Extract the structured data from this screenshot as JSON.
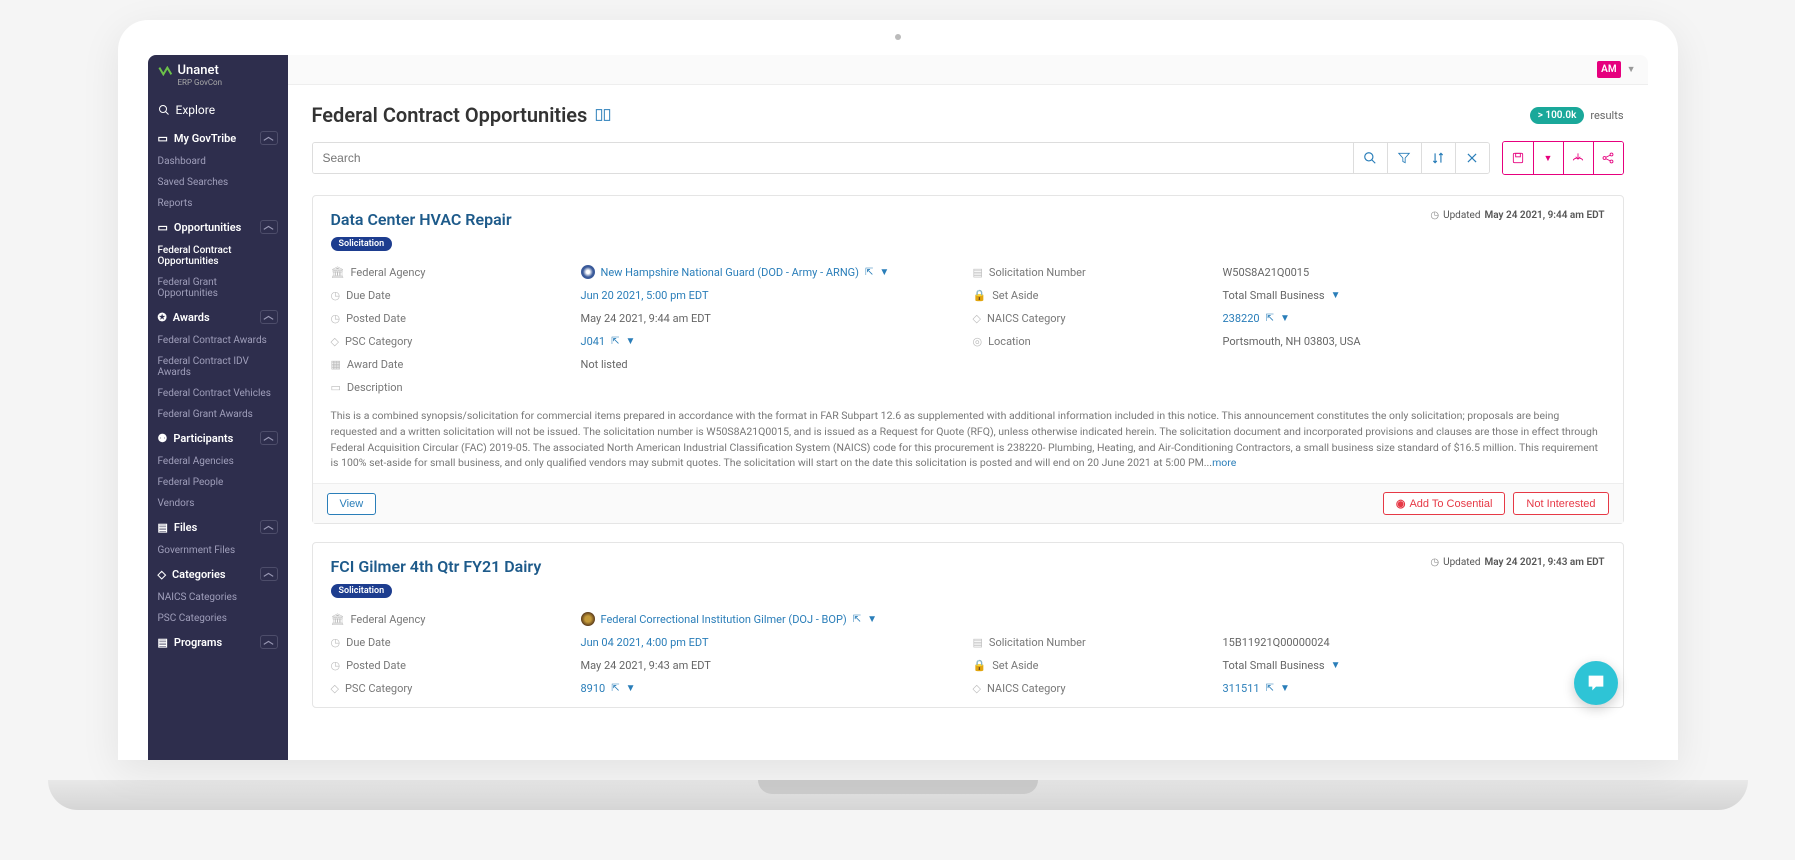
{
  "brand": {
    "name": "Unanet",
    "sub": "ERP GovCon"
  },
  "sidebar": {
    "explore": "Explore",
    "sections": [
      {
        "label": "My GovTribe",
        "items": [
          "Dashboard",
          "Saved Searches",
          "Reports"
        ]
      },
      {
        "label": "Opportunities",
        "items": [
          "Federal Contract Opportunities",
          "Federal Grant Opportunities"
        ],
        "active": 0
      },
      {
        "label": "Awards",
        "items": [
          "Federal Contract Awards",
          "Federal Contract IDV Awards",
          "Federal Contract Vehicles",
          "Federal Grant Awards"
        ]
      },
      {
        "label": "Participants",
        "items": [
          "Federal Agencies",
          "Federal People",
          "Vendors"
        ]
      },
      {
        "label": "Files",
        "items": [
          "Government Files"
        ]
      },
      {
        "label": "Categories",
        "items": [
          "NAICS Categories",
          "PSC Categories"
        ]
      },
      {
        "label": "Programs",
        "items": []
      }
    ]
  },
  "user": {
    "initials": "AM"
  },
  "page": {
    "title": "Federal Contract Opportunities",
    "results_count": "> 100.0k",
    "results_label": "results",
    "search_placeholder": "Search"
  },
  "cards": [
    {
      "title": "Data Center HVAC Repair",
      "tag": "Solicitation",
      "updated_label": "Updated",
      "updated_value": "May 24 2021, 9:44 am EDT",
      "fields": {
        "agency_label": "Federal Agency",
        "agency_value": "New Hampshire National Guard (DOD - Army - ARNG)",
        "sol_label": "Solicitation Number",
        "sol_value": "W50S8A21Q0015",
        "due_label": "Due Date",
        "due_value": "Jun 20 2021, 5:00 pm EDT",
        "setaside_label": "Set Aside",
        "setaside_value": "Total Small Business",
        "posted_label": "Posted Date",
        "posted_value": "May 24 2021, 9:44 am EDT",
        "naics_label": "NAICS Category",
        "naics_value": "238220",
        "psc_label": "PSC Category",
        "psc_value": "J041",
        "loc_label": "Location",
        "loc_value": "Portsmouth, NH 03803, USA",
        "award_label": "Award Date",
        "award_value": "Not listed",
        "desc_label": "Description",
        "desc_value": "This is a combined synopsis/solicitation for commercial items prepared in accordance with the format in FAR Subpart 12.6 as supplemented with additional information included in this notice. This announcement constitutes the only solicitation; proposals are being requested and a written solicitation will not be issued. The solicitation number is W50S8A21Q0015, and is issued as a Request for Quote (RFQ), unless otherwise indicated herein. The solicitation document and incorporated provisions and clauses are those in effect through Federal Acquisition Circular (FAC) 2019-05. The associated North American Industrial Classification System (NAICS) code for this procurement is 238220- Plumbing, Heating, and Air-Conditioning Contractors, a small business size standard of $16.5 million. This requirement is 100% set-aside for small business, and only qualified vendors may submit quotes. The solicitation will start on the date this solicitation is posted and will end on 20 June 2021 at 5:00 PM...",
        "more": "more"
      },
      "actions": {
        "view": "View",
        "cosential": "Add To Cosential",
        "not_interested": "Not Interested"
      }
    },
    {
      "title": "FCI Gilmer 4th Qtr FY21 Dairy",
      "tag": "Solicitation",
      "updated_label": "Updated",
      "updated_value": "May 24 2021, 9:43 am EDT",
      "fields": {
        "agency_label": "Federal Agency",
        "agency_value": "Federal Correctional Institution Gilmer (DOJ - BOP)",
        "sol_label": "Solicitation Number",
        "sol_value": "15B11921Q00000024",
        "due_label": "Due Date",
        "due_value": "Jun 04 2021, 4:00 pm EDT",
        "setaside_label": "Set Aside",
        "setaside_value": "Total Small Business",
        "posted_label": "Posted Date",
        "posted_value": "May 24 2021, 9:43 am EDT",
        "naics_label": "NAICS Category",
        "naics_value": "311511",
        "psc_label": "PSC Category",
        "psc_value": "8910"
      }
    }
  ]
}
